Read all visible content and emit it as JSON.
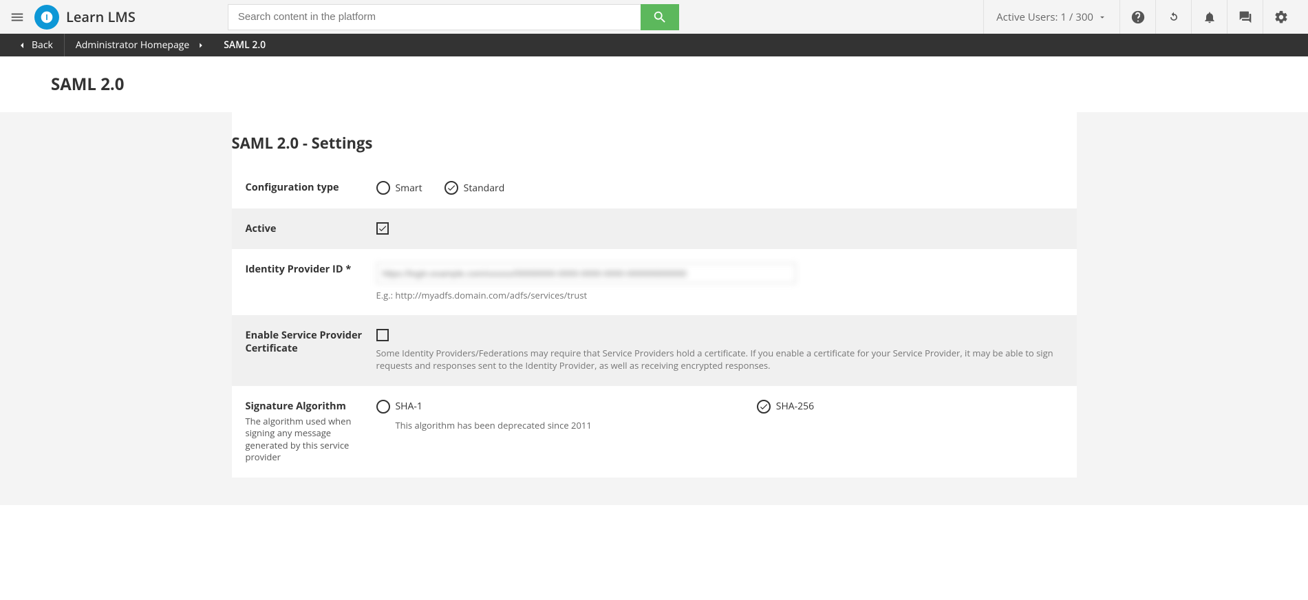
{
  "header": {
    "logo_text": "Learn LMS",
    "search_placeholder": "Search content in the platform",
    "active_users_label": "Active Users: 1 / 300"
  },
  "breadcrumb": {
    "back_label": "Back",
    "admin_label": "Administrator Homepage",
    "current_label": "SAML 2.0"
  },
  "page": {
    "title": "SAML 2.0",
    "section_title": "SAML 2.0 - Settings"
  },
  "fields": {
    "config_type": {
      "label": "Configuration type",
      "smart": "Smart",
      "standard": "Standard"
    },
    "active": {
      "label": "Active"
    },
    "idp_id": {
      "label": "Identity Provider ID *",
      "value": "https://login.example.com/xxxxxx/00000000-0000-0000-0000-000000000000",
      "example": "E.g.: http://myadfs.domain.com/adfs/services/trust"
    },
    "sp_cert": {
      "label": "Enable Service Provider Certificate",
      "help": "Some Identity Providers/Federations may require that Service Providers hold a certificate. If you enable a certificate for your Service Provider, it may be able to sign requests and responses sent to the Identity Provider, as well as receiving encrypted responses."
    },
    "sig_algo": {
      "label": "Signature Algorithm",
      "help": "The algorithm used when signing any message generated by this service provider",
      "sha1": "SHA-1",
      "sha1_help": "This algorithm has been deprecated since 2011",
      "sha256": "SHA-256"
    }
  }
}
